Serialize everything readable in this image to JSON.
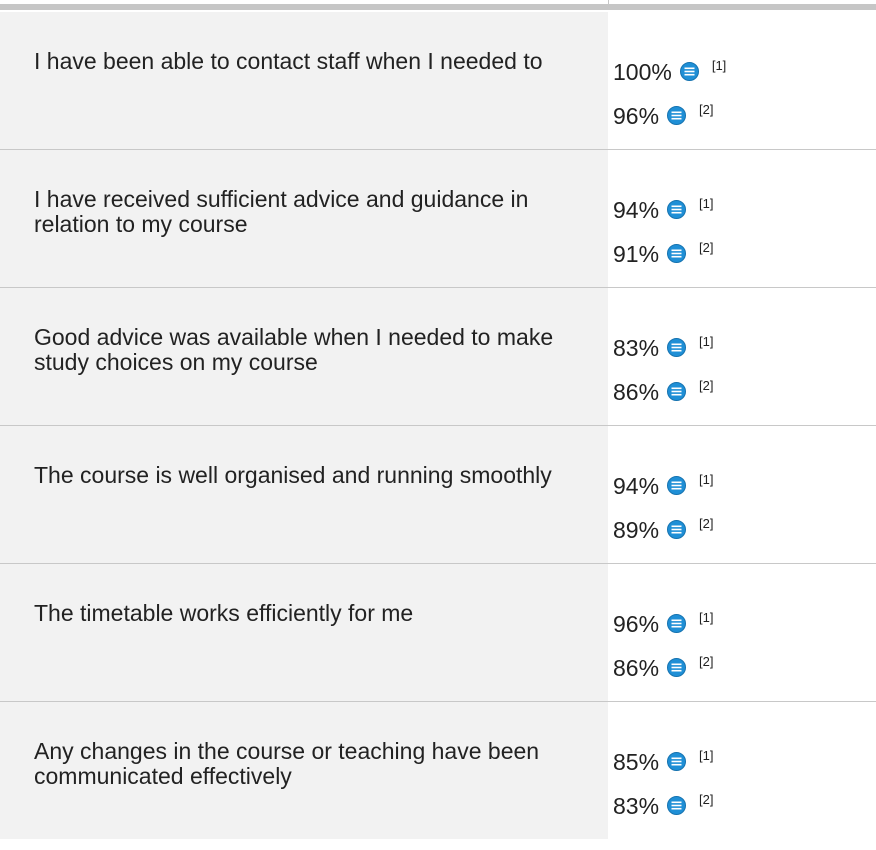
{
  "accent_color": "#1f8fd6",
  "rows": [
    {
      "question": "I have been able to contact staff when I needed to",
      "scores": [
        {
          "value": "100%",
          "ref": "[1]",
          "icon": "notes-icon"
        },
        {
          "value": "96%",
          "ref": "[2]",
          "icon": "notes-icon"
        }
      ]
    },
    {
      "question": "I have received sufficient advice and guidance in relation to my course",
      "scores": [
        {
          "value": "94%",
          "ref": "[1]",
          "icon": "notes-icon"
        },
        {
          "value": "91%",
          "ref": "[2]",
          "icon": "notes-icon"
        }
      ]
    },
    {
      "question": "Good advice was available when I needed to make study choices on my course",
      "scores": [
        {
          "value": "83%",
          "ref": "[1]",
          "icon": "notes-icon"
        },
        {
          "value": "86%",
          "ref": "[2]",
          "icon": "notes-icon"
        }
      ]
    },
    {
      "question": "The course is well organised and running smoothly",
      "scores": [
        {
          "value": "94%",
          "ref": "[1]",
          "icon": "notes-icon"
        },
        {
          "value": "89%",
          "ref": "[2]",
          "icon": "notes-icon"
        }
      ]
    },
    {
      "question": "The timetable works efficiently for me",
      "scores": [
        {
          "value": "96%",
          "ref": "[1]",
          "icon": "notes-icon"
        },
        {
          "value": "86%",
          "ref": "[2]",
          "icon": "notes-icon"
        }
      ]
    },
    {
      "question": "Any changes in the course or teaching have been communicated effectively",
      "scores": [
        {
          "value": "85%",
          "ref": "[1]",
          "icon": "notes-icon"
        },
        {
          "value": "83%",
          "ref": "[2]",
          "icon": "notes-icon"
        }
      ]
    }
  ]
}
